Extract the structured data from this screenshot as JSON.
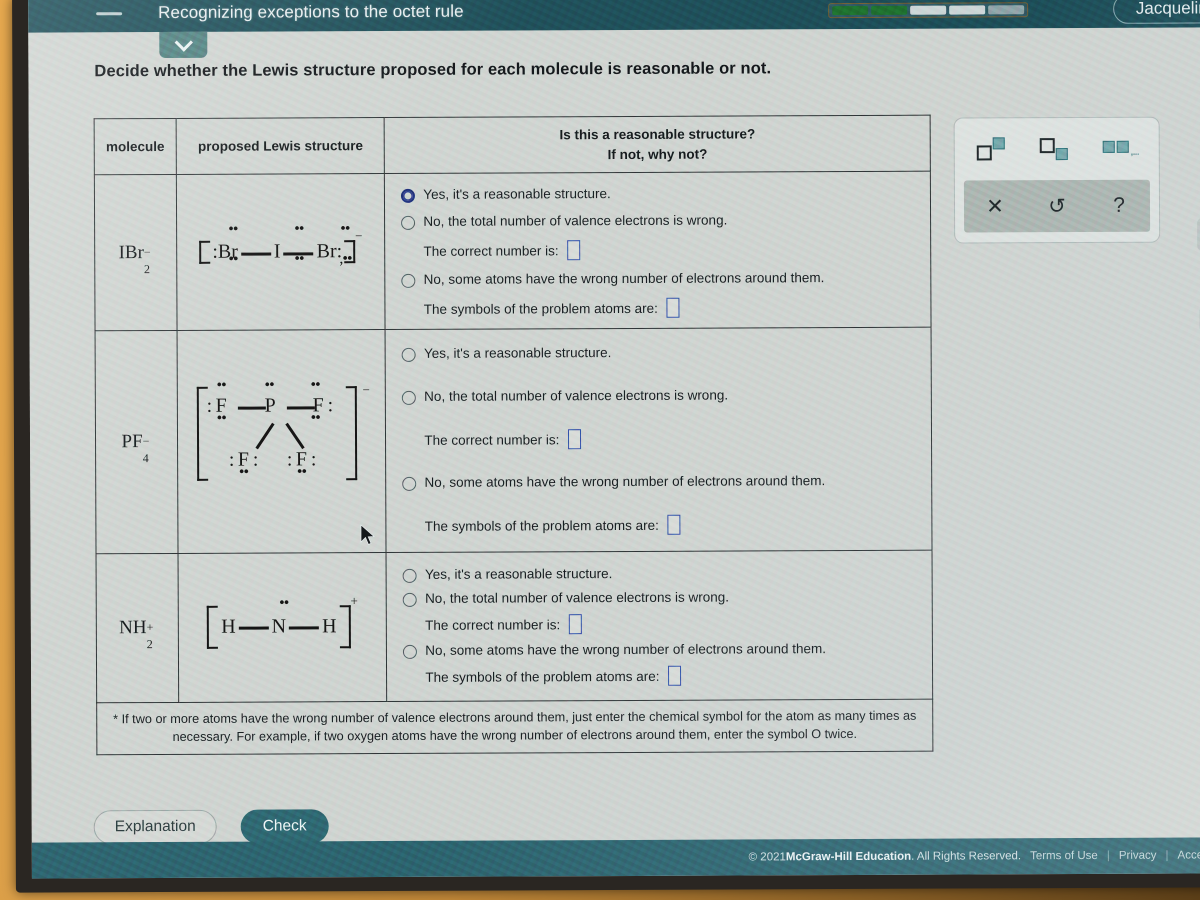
{
  "header": {
    "title": "Recognizing exceptions to the octet rule",
    "user": "Jacqueline",
    "menu_icon": "hamburger-icon",
    "progress": {
      "total": 5,
      "done": 2,
      "current": 3
    }
  },
  "collapse_tab": {
    "icon": "chevron-down-icon"
  },
  "prompt": "Decide whether the Lewis structure proposed for each molecule is reasonable or not.",
  "table": {
    "headers": {
      "molecule": "molecule",
      "structure": "proposed Lewis structure",
      "answer_line1": "Is this a reasonable structure?",
      "answer_line2": "If not, why not?"
    },
    "options": {
      "yes": "Yes, it's a reasonable structure.",
      "no_valence": "No, the total number of valence electrons is wrong.",
      "correct_number_label": "The correct number is:",
      "no_atoms": "No, some atoms have the wrong number of electrons around them.",
      "symbols_label": "The symbols of the problem atoms are:"
    },
    "rows": [
      {
        "formula": "IBr",
        "sub": "2",
        "charge": "−",
        "structure_charge": "−",
        "atoms": [
          "Br",
          "I",
          "Br"
        ],
        "correct_number_value": "",
        "symbols_value": "",
        "selected": "yes_focused"
      },
      {
        "formula": "PF",
        "sub": "4",
        "charge": "−",
        "structure_charge": "−",
        "atoms": [
          "F",
          "P",
          "F",
          "F",
          "F"
        ],
        "correct_number_value": "",
        "symbols_value": "",
        "selected": "none"
      },
      {
        "formula": "NH",
        "sub": "2",
        "charge": "+",
        "structure_charge": "+",
        "atoms": [
          "H",
          "N",
          "H"
        ],
        "correct_number_value": "",
        "symbols_value": "",
        "selected": "none"
      }
    ]
  },
  "footnote": "* If two or more atoms have the wrong number of valence electrons around them, just enter the chemical symbol for the atom as many times as necessary. For example, if two oxygen atoms have the wrong number of electrons around them, enter the symbol O twice.",
  "buttons": {
    "explanation": "Explanation",
    "check": "Check"
  },
  "mathbar": {
    "superscript_icon": "superscript-icon",
    "subscript_icon": "subscript-icon",
    "list_icon": "multiple-entry-icon",
    "clear": "✕",
    "undo": "↺",
    "help": "?"
  },
  "footer": {
    "copyright_a": "© 2021 ",
    "copyright_b": "McGraw-Hill Education",
    "copyright_c": ". All Rights Reserved.",
    "terms": "Terms of Use",
    "privacy": "Privacy",
    "accessibility": "Acces",
    "sep": "|"
  },
  "colors": {
    "header_bg": "#1b4a55",
    "footer_bg": "#2a5f6b",
    "accent": "#2c636e",
    "input_border": "#2f4ea8",
    "progress_done": "#1d6b2d"
  }
}
